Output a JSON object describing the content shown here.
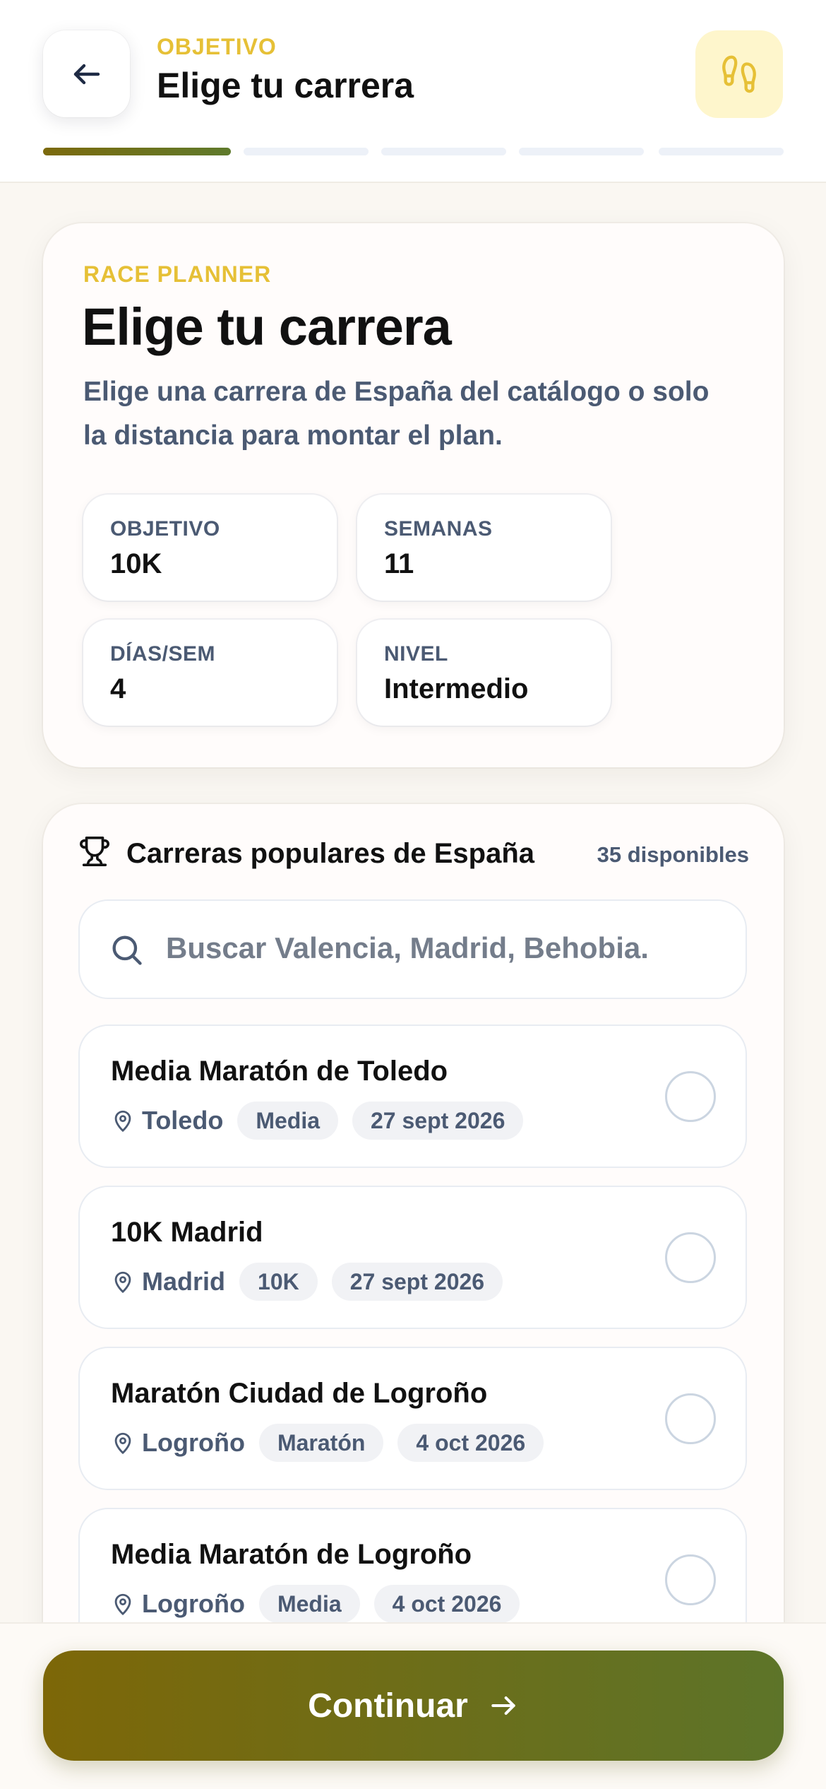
{
  "header": {
    "kicker": "OBJETIVO",
    "title": "Elige tu carrera",
    "progress_steps": 5,
    "progress_current": 1,
    "back_icon": "arrow-left-icon",
    "steps_icon": "footprints-icon"
  },
  "planner": {
    "kicker": "RACE PLANNER",
    "title": "Elige tu carrera",
    "description": "Elige una carrera de España del catálogo o solo la distancia para montar el plan.",
    "stats": [
      {
        "label": "OBJETIVO",
        "value": "10K"
      },
      {
        "label": "SEMANAS",
        "value": "11"
      },
      {
        "label": "DÍAS/SEM",
        "value": "4"
      },
      {
        "label": "NIVEL",
        "value": "Intermedio"
      }
    ]
  },
  "races_section": {
    "title": "Carreras populares de España",
    "count": "35 disponibles",
    "search_placeholder": "Buscar Valencia, Madrid, Behobia.",
    "races": [
      {
        "name": "Media Maratón de Toledo",
        "city": "Toledo",
        "distance": "Media",
        "date": "27 sept 2026"
      },
      {
        "name": "10K Madrid",
        "city": "Madrid",
        "distance": "10K",
        "date": "27 sept 2026"
      },
      {
        "name": "Maratón Ciudad de Logroño",
        "city": "Logroño",
        "distance": "Maratón",
        "date": "4 oct 2026"
      },
      {
        "name": "Media Maratón de Logroño",
        "city": "Logroño",
        "distance": "Media",
        "date": "4 oct 2026"
      }
    ]
  },
  "footer": {
    "continue_label": "Continuar"
  },
  "colors": {
    "accent_yellow": "#e6c036",
    "cta_start": "#7d6708",
    "cta_end": "#5d7429",
    "muted_text": "#4b5a73"
  }
}
